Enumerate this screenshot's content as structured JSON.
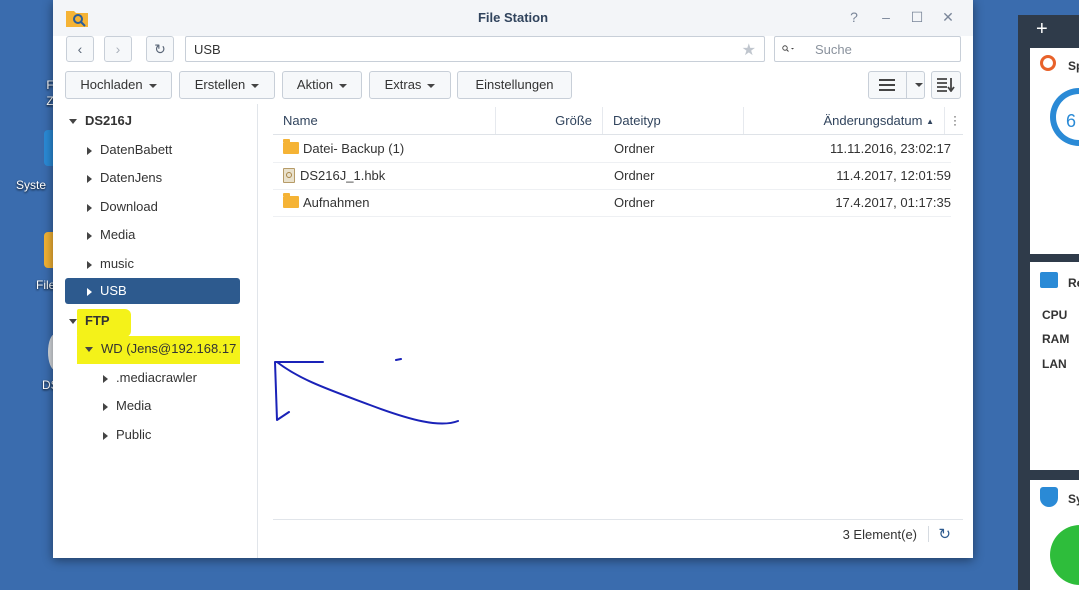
{
  "desktop": {
    "icons": [
      {
        "label": "F\nZ",
        "short": "Z"
      },
      {
        "label": "Syste"
      },
      {
        "label": "File"
      },
      {
        "label": "DS"
      }
    ]
  },
  "window": {
    "title": "File Station",
    "controls": {
      "help": "?",
      "minimize": "–",
      "maximize": "☐",
      "close": "✕"
    },
    "nav": {
      "back": "‹",
      "forward": "›",
      "refresh": "↻"
    },
    "path": "USB",
    "search_placeholder": "Suche",
    "toolbar": {
      "upload": "Hochladen",
      "create": "Erstellen",
      "action": "Aktion",
      "extras": "Extras",
      "settings": "Einstellungen"
    },
    "tree": {
      "root": "DS216J",
      "shares": [
        "DatenBabett",
        "DatenJens",
        "Download",
        "Media",
        "music",
        "USB"
      ],
      "selected": "USB",
      "ftp": "FTP",
      "ftp_server": "WD (Jens@192.168.17",
      "ftp_children": [
        ".mediacrawler",
        "Media",
        "Public"
      ]
    },
    "columns": {
      "name": "Name",
      "size": "Größe",
      "type": "Dateityp",
      "modified": "Änderungsdatum"
    },
    "files": [
      {
        "name": "Datei- Backup (1)",
        "icon": "folder-icon",
        "size": "",
        "type": "Ordner",
        "modified": "11.11.2016, 23:02:17"
      },
      {
        "name": "DS216J_1.hbk",
        "icon": "hbk-file-icon",
        "size": "",
        "type": "Ordner",
        "modified": "11.4.2017, 12:01:59"
      },
      {
        "name": "Aufnahmen",
        "icon": "folder-icon",
        "size": "",
        "type": "Ordner",
        "modified": "17.4.2017, 01:17:35"
      }
    ],
    "status": {
      "count": "3 Element(e)"
    }
  },
  "widgets": {
    "add": "+",
    "storage_label": "Sp",
    "storage_value": "6",
    "resource_label": "Re",
    "resource_rows": [
      "CPU",
      "RAM",
      "LAN"
    ],
    "system_label": "Sy"
  },
  "colors": {
    "desktop": "#3a6cae",
    "selection": "#2d5a8e",
    "highlight": "#f4f219",
    "annotation": "#1a22b8",
    "folder": "#f5b335"
  }
}
